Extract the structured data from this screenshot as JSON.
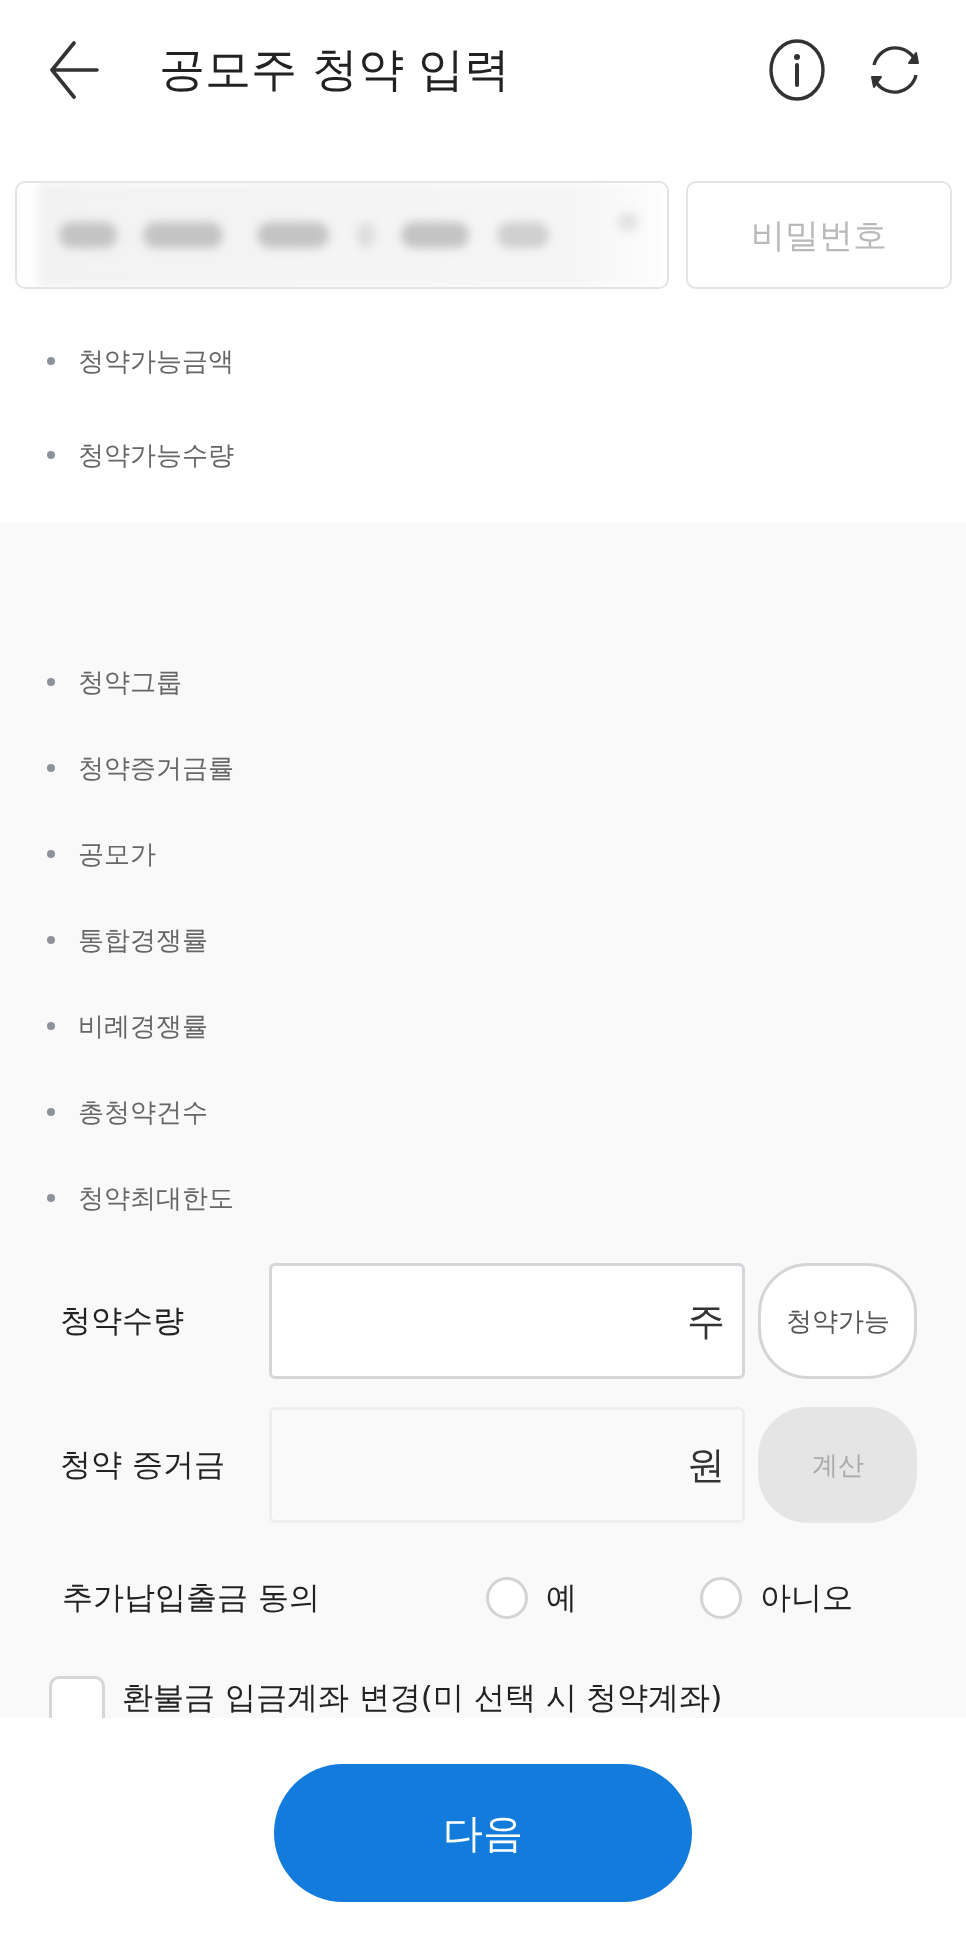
{
  "header": {
    "title": "공모주 청약 입력"
  },
  "account": {
    "password_placeholder": "비밀번호"
  },
  "balance_items": [
    {
      "label": "청약가능금액"
    },
    {
      "label": "청약가능수량"
    }
  ],
  "offering_items": [
    {
      "label": "청약그룹"
    },
    {
      "label": "청약증거금률"
    },
    {
      "label": "공모가"
    },
    {
      "label": "통합경쟁률"
    },
    {
      "label": "비례경쟁률"
    },
    {
      "label": "총청약건수"
    },
    {
      "label": "청약최대한도"
    }
  ],
  "form": {
    "rows": [
      {
        "label": "청약수량",
        "unit": "주",
        "button": "청약가능",
        "disabled": false
      },
      {
        "label": "청약 증거금",
        "unit": "원",
        "button": "계산",
        "disabled": true
      }
    ],
    "consent": {
      "label": "추가납입출금 동의",
      "options": [
        {
          "label": "예",
          "selected": false
        },
        {
          "label": "아니오",
          "selected": false
        }
      ]
    },
    "refund_change": {
      "label": "환불금 입금계좌 변경(미 선택 시 청약계좌)",
      "checked": false
    }
  },
  "footer": {
    "next_button": "다음"
  }
}
